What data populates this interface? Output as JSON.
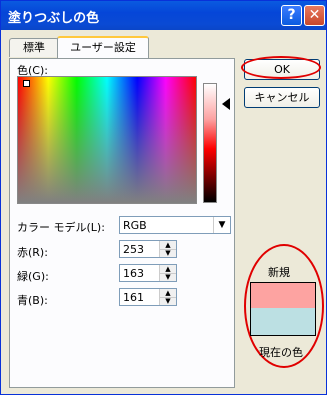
{
  "window": {
    "title": "塗りつぶしの色",
    "help_glyph": "?",
    "close_glyph": "✕"
  },
  "tabs": [
    {
      "label": "標準"
    },
    {
      "label": "ユーザー設定"
    }
  ],
  "color_label": "色(C):",
  "color_model": {
    "label": "カラー モデル(L):",
    "value": "RGB"
  },
  "channels": [
    {
      "label": "赤(R):",
      "value": "253"
    },
    {
      "label": "緑(G):",
      "value": "163"
    },
    {
      "label": "青(B):",
      "value": "161"
    }
  ],
  "buttons": {
    "ok": "OK",
    "cancel": "キャンセル"
  },
  "preview": {
    "new_label": "新規",
    "current_label": "現在の色",
    "new_color": "#fda3a1",
    "current_color": "#bce0e3"
  },
  "annotation_color": "#e00000"
}
